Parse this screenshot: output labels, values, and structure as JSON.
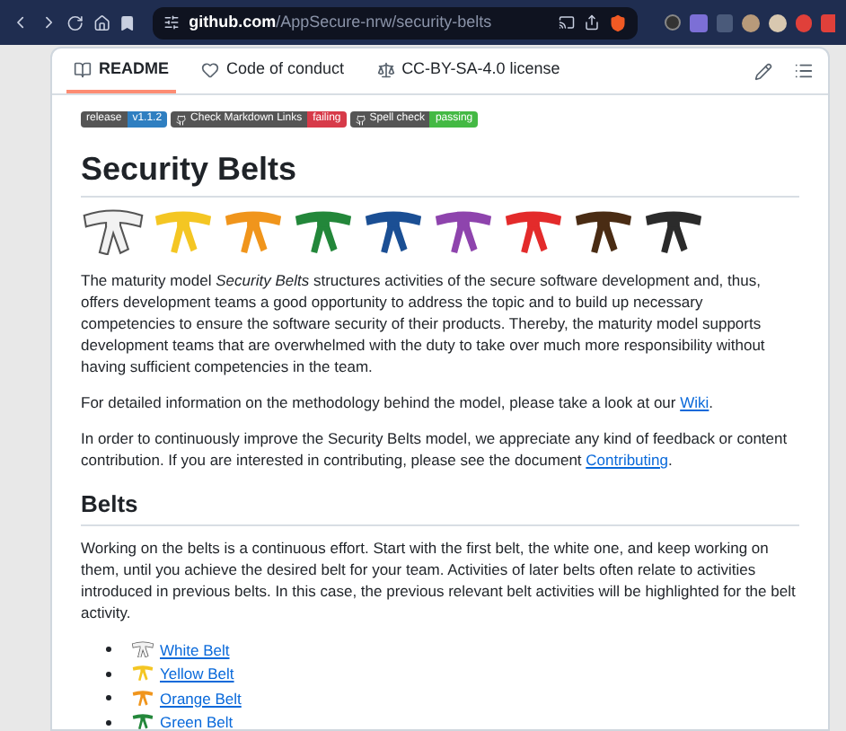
{
  "browser": {
    "url_host": "github.com",
    "url_path": "/AppSecure-nrw/security-belts"
  },
  "tabs": [
    {
      "label": "README",
      "selected": true
    },
    {
      "label": "Code of conduct",
      "selected": false
    },
    {
      "label": "CC-BY-SA-4.0 license",
      "selected": false
    }
  ],
  "badges": [
    {
      "label": "release",
      "value": "v1.1.2",
      "color": "#2f7fc1",
      "github": false
    },
    {
      "label": "Check Markdown Links",
      "value": "failing",
      "color": "#d73a49",
      "github": true
    },
    {
      "label": "Spell check",
      "value": "passing",
      "color": "#44b944",
      "github": true
    }
  ],
  "title": "Security Belts",
  "belts": [
    {
      "color": "#f2f2f2"
    },
    {
      "color": "#f4c623"
    },
    {
      "color": "#f0951c"
    },
    {
      "color": "#23873a"
    },
    {
      "color": "#1b4f94"
    },
    {
      "color": "#8e44ad"
    },
    {
      "color": "#e32b2b"
    },
    {
      "color": "#4a2c14"
    },
    {
      "color": "#2b2b2b"
    }
  ],
  "intro": "The maturity model *Security Belts* structures activities of the secure software development and, thus, offers development teams a good opportunity to address the topic and to build up necessary competencies to ensure the software security of their products. Thereby, the maturity model supports development teams that are overwhelmed with the duty to take over much more responsibility without having sufficient competencies in the team.",
  "paragraphs": [
    {
      "before": "For detailed information on the methodology behind the model, please take a look at our ",
      "link": "Wiki",
      "after": "."
    },
    {
      "before": "In order to continuously improve the Security Belts model, we appreciate any kind of feedback or content contribution. If you are interested in contributing, please see the document ",
      "link": "Contributing",
      "after": "."
    }
  ],
  "belts_heading": "Belts",
  "belts_text": "Working on the belts is a continuous effort. Start with the first belt, the white one, and keep working on them, until you achieve the desired belt for your team. Activities of later belts often relate to activities introduced in previous belts. In this case, the previous relevant belt activities will be highlighted for the belt activity.",
  "belt_links": [
    {
      "label": "White Belt",
      "color": "#f2f2f2"
    },
    {
      "label": "Yellow Belt",
      "color": "#f4c623"
    },
    {
      "label": "Orange Belt",
      "color": "#f0951c"
    },
    {
      "label": "Green Belt",
      "color": "#23873a"
    }
  ]
}
